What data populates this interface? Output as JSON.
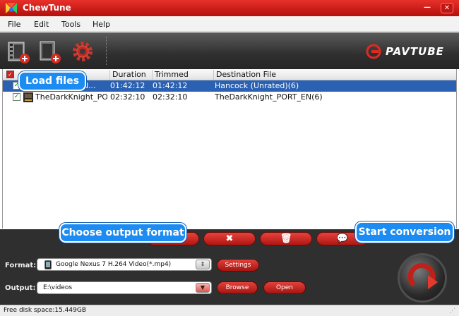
{
  "window": {
    "title": "ChewTune",
    "minimize": "—",
    "close": "✕"
  },
  "menu": {
    "items": [
      "File",
      "Edit",
      "Tools",
      "Help"
    ]
  },
  "toolbar": {
    "buttons": [
      "film-add-icon",
      "folder-add-icon",
      "settings-gear-icon"
    ],
    "brand": "PAVTUBE"
  },
  "file_list": {
    "columns": [
      "Duration",
      "Trimmed Length",
      "Destination File"
    ],
    "rows": [
      {
        "name": "Hancock (Unrated...",
        "name_visible": "ted...",
        "duration": "01:42:12",
        "trimmed": "01:42:12",
        "destination": "Hancock (Unrated)(6)",
        "selected": true,
        "checked": true
      },
      {
        "name": "TheDarkKnight_PO...",
        "duration": "02:32:10",
        "trimmed": "02:32:10",
        "destination": "TheDarkKnight_PORT_EN(6)",
        "selected": false,
        "checked": true
      }
    ]
  },
  "actions": {
    "icons": [
      "merge-icon",
      "remove-icon",
      "delete-icon",
      "subtitle-icon"
    ]
  },
  "format": {
    "label": "Format:",
    "value": "Google Nexus 7 H.264 Video(*.mp4)",
    "settings_label": "Settings"
  },
  "output": {
    "label": "Output:",
    "value": "E:\\videos",
    "browse_label": "Browse",
    "open_label": "Open"
  },
  "status": {
    "free_space": "Free disk space:15.449GB"
  },
  "callouts": {
    "load_files": "Load files",
    "choose_format": "Choose output format",
    "start_conversion": "Start conversion"
  },
  "colors": {
    "accent_red": "#c21510",
    "callout_blue": "#1d8cf2",
    "selection": "#2b61b3"
  }
}
